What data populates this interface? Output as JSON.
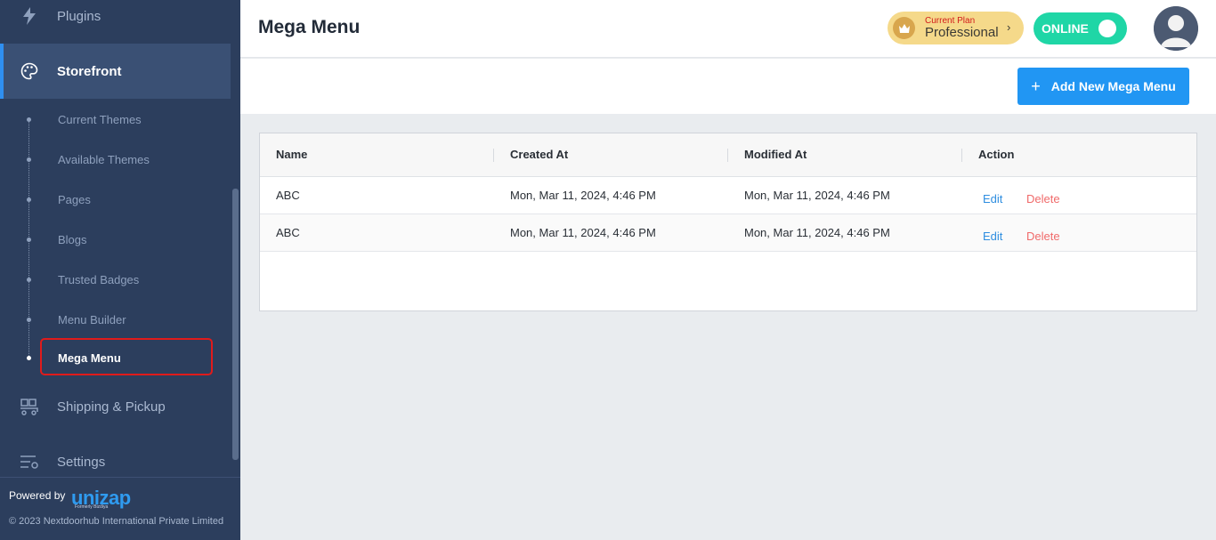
{
  "sidebar": {
    "nav": {
      "plugins": "Plugins",
      "storefront": "Storefront",
      "shipping": "Shipping & Pickup",
      "settings": "Settings"
    },
    "subitems": [
      {
        "label": "Current Themes"
      },
      {
        "label": "Available Themes"
      },
      {
        "label": "Pages"
      },
      {
        "label": "Blogs"
      },
      {
        "label": "Trusted Badges"
      },
      {
        "label": "Menu Builder"
      },
      {
        "label": "Mega Menu"
      }
    ],
    "footer": {
      "powered_by": "Powered by",
      "logo": "unizap",
      "logo_sub": "Formerly Bizdiya",
      "copyright": "© 2023 Nextdoorhub International Private Limited"
    }
  },
  "header": {
    "title": "Mega Menu",
    "plan": {
      "small": "Current Plan",
      "name": "Professional",
      "chevron": "›"
    },
    "status": "ONLINE"
  },
  "toolbar": {
    "add_button": "Add New Mega Menu",
    "add_icon": "+"
  },
  "table": {
    "columns": [
      "Name",
      "Created At",
      "Modified At",
      "Action"
    ],
    "rows": [
      {
        "name": "ABC",
        "created": "Mon, Mar 11, 2024, 4:46 PM",
        "modified": "Mon, Mar 11, 2024, 4:46 PM",
        "edit": "Edit",
        "delete": "Delete"
      },
      {
        "name": "ABC",
        "created": "Mon, Mar 11, 2024, 4:46 PM",
        "modified": "Mon, Mar 11, 2024, 4:46 PM",
        "edit": "Edit",
        "delete": "Delete"
      }
    ]
  },
  "colors": {
    "sidebar_bg": "#2c3e5d",
    "active_bg": "#3a5074",
    "accent": "#2196f3",
    "online": "#1fd6a6",
    "delete": "#f06a6a",
    "highlight": "#e01b1b"
  }
}
